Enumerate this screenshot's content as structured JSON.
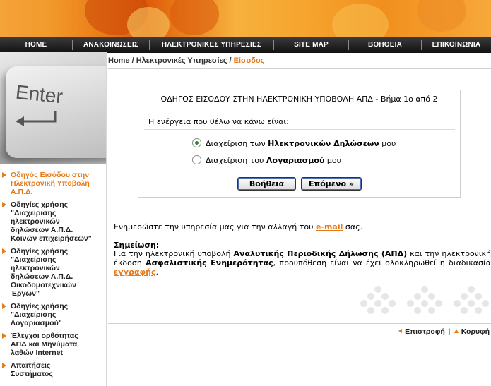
{
  "nav": {
    "items": [
      "HOME",
      "ΑΝΑΚΟΙΝΩΣΕΙΣ",
      "ΗΛΕΚΤΡΟΝΙΚΕΣ ΥΠΗΡΕΣΙΕΣ",
      "SITE MAP",
      "ΒΟΗΘΕΙΑ",
      "ΕΠΙΚΟΙΝΩΝΙΑ"
    ]
  },
  "key_image": {
    "label": "Enter"
  },
  "sidebar": {
    "items": [
      "Οδηγός Εισόδου στην\nΗλεκτρονική Υποβολή\nΑ.Π.Δ.",
      "Οδηγίες χρήσης\n\"Διαχείρισης\nηλεκτρονικών\nδηλώσεων Α.Π.Δ.\nΚοινών επιχειρήσεων\"",
      "Οδηγίες χρήσης\n\"Διαχείρισης\nηλεκτρονικών\nδηλώσεων Α.Π.Δ.\nΟικοδομοτεχνικών\nΈργων\"",
      "Οδηγίες χρήσης\n\"Διαχείρισης\nΛογαριασμού\"",
      "Έλεγχοι ορθότητας\nΑΠΔ και Μηνύματα\nλαθών Internet",
      "Απαιτήσεις\nΣυστήματος"
    ]
  },
  "breadcrumb": {
    "home": "Home",
    "sep": " / ",
    "services": "Ηλεκτρονικές Υπηρεσίες",
    "current": "Είσοδος"
  },
  "wizard": {
    "title": "ΟΔΗΓΟΣ ΕΙΣΟΔΟΥ ΣΤΗΝ ΗΛΕΚΤΡΟΝΙΚΗ ΥΠΟΒΟΛΗ ΑΠΔ - Βήμα 1ο από 2",
    "prompt": "Η ενέργεια που θέλω να κάνω είναι:",
    "option1": {
      "pre": "Διαχείριση των ",
      "bold": "Ηλεκτρονικών Δηλώσεων",
      "post": " μου"
    },
    "option2": {
      "pre": "Διαχείριση του ",
      "bold": "Λογαριασμού",
      "post": " μου"
    },
    "help_button": "Βοήθεια",
    "next_button": "Επόμενο »"
  },
  "email_msg": {
    "pre": "Ενημερώστε την υπηρεσία μας για την αλλαγή του ",
    "link": "e-mail",
    "post": " σας."
  },
  "note": {
    "title": "Σημείωση:",
    "t1": "Για την ηλεκτρονική υποβολή ",
    "b1": "Αναλυτικής Περιοδικής Δήλωσης (ΑΠΔ)",
    "t2": " και την ηλεκτρονική έκδοση ",
    "b2": "Ασφαλιστικής Ενημερότητας",
    "t3": ", προϋπόθεση είναι να έχει ολοκληρωθεί η διαδικασία ",
    "link": "εγγραφής",
    "t4": "."
  },
  "footer": {
    "back": "Επιστροφή",
    "sep": "|",
    "top": "Κορυφή"
  },
  "colors": {
    "accent": "#e57a1a",
    "nav_bg": "#1a1a1a"
  }
}
